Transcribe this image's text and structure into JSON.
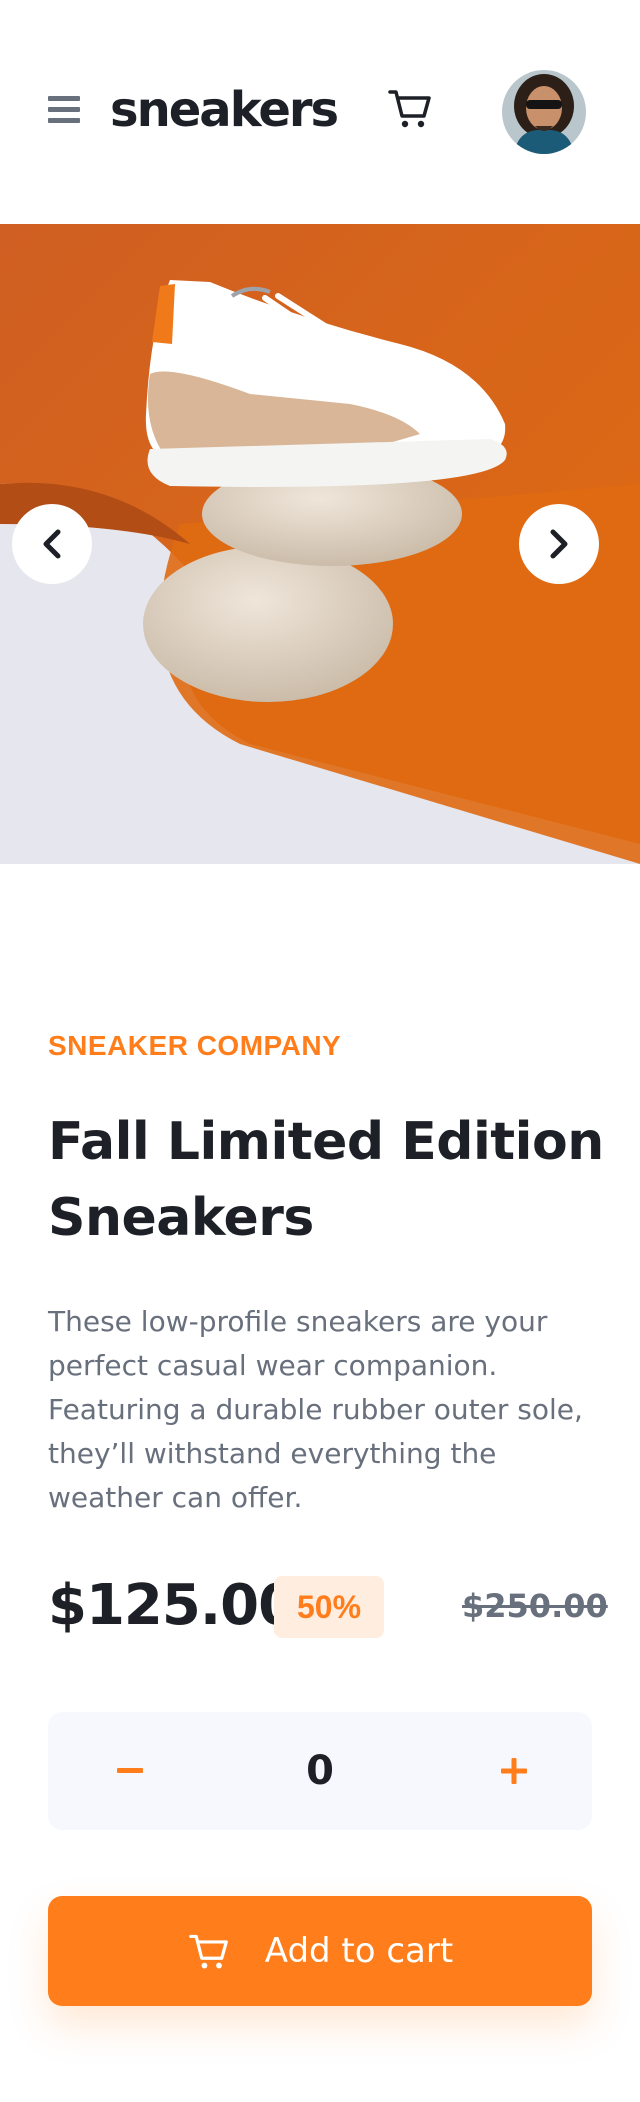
{
  "header": {
    "logo": "sneakers",
    "menu_icon": "hamburger-icon",
    "cart_icon": "cart-icon",
    "avatar_alt": "user avatar"
  },
  "gallery": {
    "prev_icon": "chevron-left-icon",
    "next_icon": "chevron-right-icon"
  },
  "product": {
    "company": "SNEAKER COMPANY",
    "title": "Fall Limited Edition Sneakers",
    "description": "These low-profile sneakers are your perfect casual wear companion. Featuring a durable rubber outer sole, they’ll withstand everything the weather can offer.",
    "price": "$125.00",
    "discount": "50%",
    "original_price": "$250.00"
  },
  "stepper": {
    "minus_label": "−",
    "quantity": "0",
    "plus_label": "+"
  },
  "cta": {
    "label": "Add to cart",
    "icon": "cart-icon"
  },
  "colors": {
    "accent": "#ff7e1b",
    "accent_pale": "#ffede0",
    "text_dark": "#1d2026",
    "text_gray": "#69707d",
    "stepper_bg": "#f6f8fd"
  }
}
